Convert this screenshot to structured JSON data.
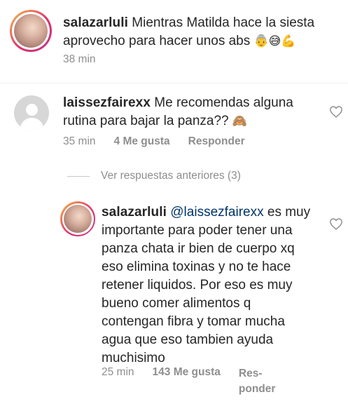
{
  "caption": {
    "username": "salazarluli",
    "text": "Mientras Matilda hace la siesta aprovecho para hacer unos abs",
    "emojis": "👵😅💪",
    "time": "38 min"
  },
  "comment": {
    "username": "laissezfairexx",
    "text": "Me recomendas alguna rutina para bajar la panza??",
    "emoji": "🙈",
    "time": "35 min",
    "likes": "4 Me gusta",
    "reply_label": "Responder"
  },
  "view_previous": "Ver respuestas anteriores (3)",
  "reply": {
    "username": "salazarluli",
    "mention": "@laissezfairexx",
    "text": "es muy importante para poder tener una panza chata ir bien de cuerpo xq eso elimina toxinas y no te hace retener liquidos. Por eso es muy bueno comer alimentos q contengan fibra y tomar mucha agua que eso tambien ayuda muchisimo",
    "time": "25 min",
    "likes": "143 Me gusta",
    "reply_label_1": "Res-",
    "reply_label_2": "ponder"
  },
  "colors": {
    "text": "#262626",
    "secondary": "#8e8e8e",
    "mention": "#003569",
    "ring_start": "#f5c04a",
    "ring_end": "#c13584"
  },
  "icons": [
    "heart-outline-icon",
    "generic-avatar-icon"
  ]
}
